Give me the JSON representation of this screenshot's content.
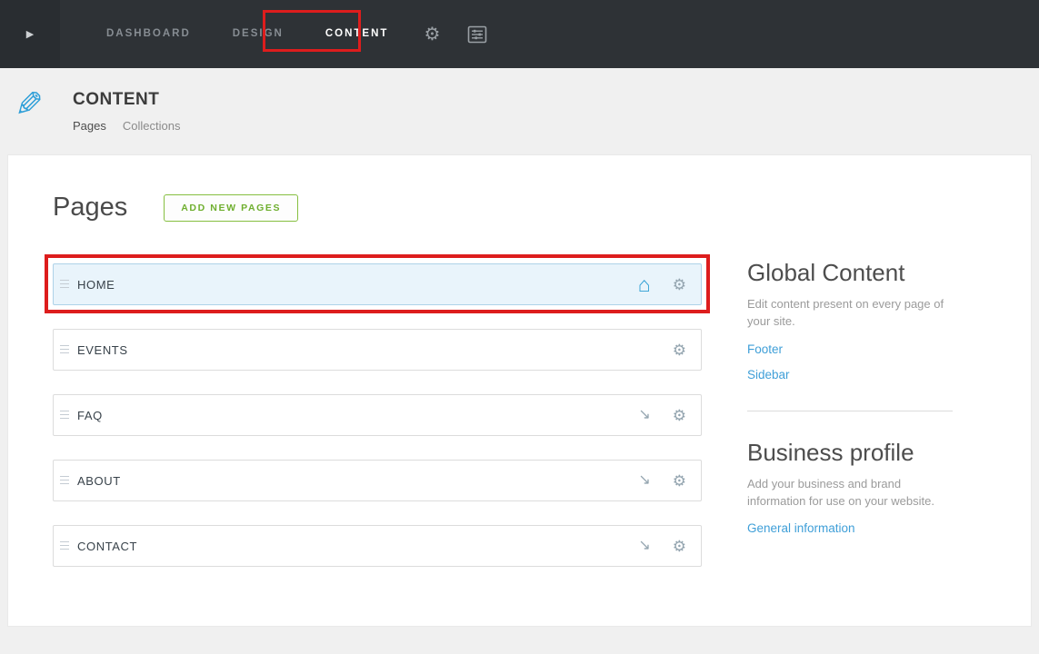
{
  "icons": {
    "play": "▶",
    "gear": "⚙",
    "pencil": "✎",
    "home": "⌂",
    "arrow": "↘"
  },
  "topbar": {
    "nav": [
      {
        "label": "DASHBOARD"
      },
      {
        "label": "DESIGN"
      },
      {
        "label": "CONTENT"
      }
    ]
  },
  "header": {
    "title": "CONTENT",
    "tabs": [
      {
        "label": "Pages"
      },
      {
        "label": "Collections"
      }
    ]
  },
  "pages_section": {
    "heading": "Pages",
    "add_button": "ADD NEW PAGES",
    "items": [
      {
        "label": "HOME",
        "highlighted": true,
        "icons": [
          "home",
          "gear"
        ]
      },
      {
        "label": "EVENTS",
        "highlighted": false,
        "icons": [
          "gear"
        ]
      },
      {
        "label": "FAQ",
        "highlighted": false,
        "icons": [
          "arrow",
          "gear"
        ]
      },
      {
        "label": "ABOUT",
        "highlighted": false,
        "icons": [
          "arrow",
          "gear"
        ]
      },
      {
        "label": "CONTACT",
        "highlighted": false,
        "icons": [
          "arrow",
          "gear"
        ]
      }
    ]
  },
  "right_column": {
    "global_content": {
      "title": "Global Content",
      "description": "Edit content present on every page of your site.",
      "links": [
        {
          "label": "Footer"
        },
        {
          "label": "Sidebar"
        }
      ]
    },
    "business_profile": {
      "title": "Business profile",
      "description": "Add your business and brand information for use on your website.",
      "links": [
        {
          "label": "General information"
        }
      ]
    }
  },
  "annotations": {
    "boxes": [
      "content-nav-tab",
      "home-page-row"
    ]
  },
  "colors": {
    "topbar_bg": "#2e3236",
    "accent_blue": "#2f9fd8",
    "link_blue": "#3f9fd8",
    "button_green": "#6faf2f",
    "annotation_red": "#dd1d1d",
    "highlight_row_bg": "#e9f4fb"
  }
}
